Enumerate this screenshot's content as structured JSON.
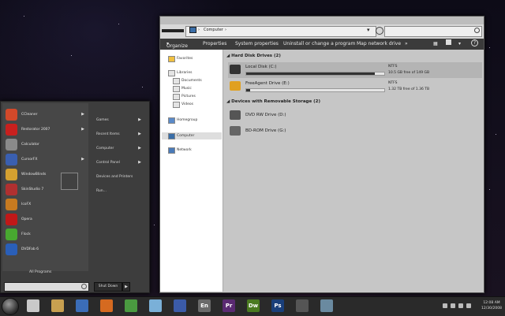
{
  "explorer": {
    "breadcrumb": [
      "Computer"
    ],
    "toolbar": {
      "organize": "Organize",
      "properties": "Properties",
      "system_properties": "System properties",
      "uninstall": "Uninstall or change a program",
      "map_drive": "Map network drive",
      "more": "»"
    },
    "sidebar": {
      "favorites": "Favorites",
      "libraries": "Libraries",
      "documents": "Documents",
      "music": "Music",
      "pictures": "Pictures",
      "videos": "Videos",
      "homegroup": "Homegroup",
      "computer": "Computer",
      "network": "Network"
    },
    "groups": {
      "hard_disks": "Hard Disk Drives (2)",
      "removable": "Devices with Removable Storage (2)"
    },
    "drives": [
      {
        "name": "Local Disk (C:)",
        "fs": "NTFS",
        "free": "10.5 GB free of 149 GB",
        "used_fraction": 0.93
      },
      {
        "name": "FreeAgent Drive (E:)",
        "fs": "NTFS",
        "free": "1.32 TB free of 1.36 TB",
        "used_fraction": 0.03
      }
    ],
    "removable": [
      {
        "name": "DVD RW Drive (D:)"
      },
      {
        "name": "BD-ROM Drive (G:)"
      }
    ]
  },
  "start_menu": {
    "programs": [
      {
        "label": "CCleaner",
        "arrow": "▶",
        "color": "#d2492a"
      },
      {
        "label": "Restorator 2007",
        "arrow": "▶",
        "color": "#c8201e"
      },
      {
        "label": "Calculator",
        "arrow": "",
        "color": "#8a8a8a"
      },
      {
        "label": "CursorFX",
        "arrow": "▶",
        "color": "#3a5fb0"
      },
      {
        "label": "WindowBlinds",
        "arrow": "",
        "color": "#d4a030"
      },
      {
        "label": "SkinStudio 7",
        "arrow": "",
        "color": "#b03030"
      },
      {
        "label": "IcoFX",
        "arrow": "",
        "color": "#c77a20"
      },
      {
        "label": "Opera",
        "arrow": "",
        "color": "#c01818"
      },
      {
        "label": "Flock",
        "arrow": "",
        "color": "#48a830"
      },
      {
        "label": "DVDFab 6",
        "arrow": "",
        "color": "#2a5fb8"
      }
    ],
    "right_items": [
      {
        "label": "Games",
        "arrow": "▶"
      },
      {
        "label": "Recent Items",
        "arrow": "▶"
      },
      {
        "label": "Computer",
        "arrow": "▶"
      },
      {
        "label": "Control Panel",
        "arrow": "▶"
      },
      {
        "label": "Devices and Printers",
        "arrow": ""
      },
      {
        "label": "Run...",
        "arrow": ""
      }
    ],
    "all_programs": "All Programs",
    "shutdown": "Shut Down",
    "shutdown_arrow": "▶"
  },
  "taskbar": {
    "apps": [
      {
        "name": "notes-icon",
        "color": "#c9c9c9",
        "text": ""
      },
      {
        "name": "mail-icon",
        "color": "#c8a050",
        "text": ""
      },
      {
        "name": "thunderbird-icon",
        "color": "#3b6db8",
        "text": ""
      },
      {
        "name": "star-icon",
        "color": "#d56a20",
        "text": ""
      },
      {
        "name": "chrome-icon",
        "color": "#4a9a40",
        "text": ""
      },
      {
        "name": "explorer-icon",
        "color": "#7ab0d8",
        "text": ""
      },
      {
        "name": "word-icon",
        "color": "#3b5ba8",
        "text": ""
      },
      {
        "name": "encore-icon",
        "color": "#6a6a6a",
        "text": "En"
      },
      {
        "name": "premiere-icon",
        "color": "#5a2a72",
        "text": "Pr"
      },
      {
        "name": "dreamweaver-icon",
        "color": "#4a7a20",
        "text": "Dw"
      },
      {
        "name": "photoshop-icon",
        "color": "#1a3f7a",
        "text": "Ps"
      },
      {
        "name": "media-icon",
        "color": "#555555",
        "text": ""
      },
      {
        "name": "network-tool-icon",
        "color": "#6a8aa0",
        "text": ""
      }
    ],
    "time": "12:08 AM",
    "date": "12/30/2008"
  }
}
